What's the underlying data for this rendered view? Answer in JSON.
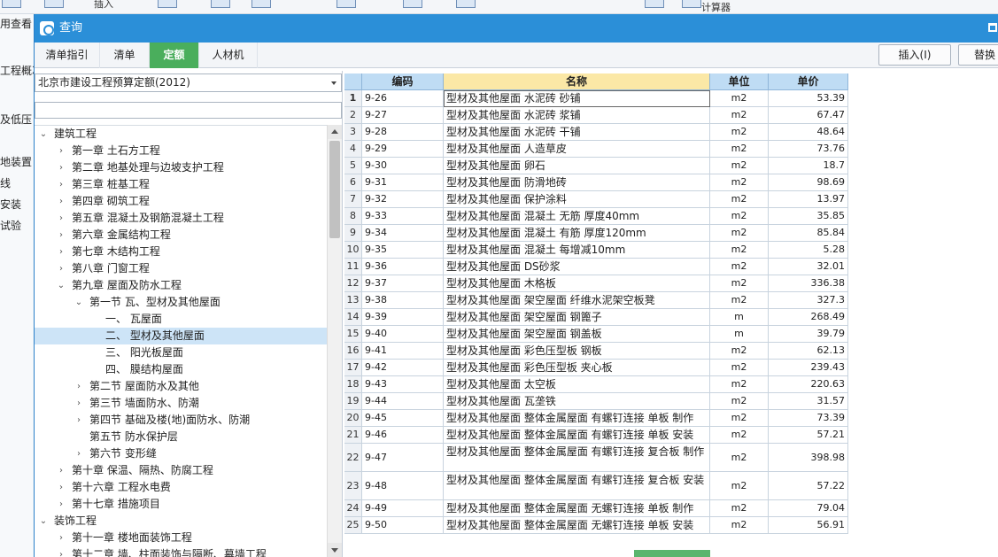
{
  "background": {
    "toolbar_items": [
      "插入",
      "计算器"
    ],
    "left_items": [
      "用查看",
      "工程概况",
      "及低压",
      "地装置",
      "线",
      "安装",
      "试验"
    ]
  },
  "dialog": {
    "title": "查询",
    "tabs": [
      "清单指引",
      "清单",
      "定额",
      "人材机"
    ],
    "active_tab": "定额",
    "insert_button": "插入(I)",
    "replace_button": "替换",
    "accent": "#4aae5c",
    "title_color": "#2b8fd8"
  },
  "left": {
    "quota_library": "北京市建设工程预算定额(2012)",
    "search_value": "",
    "tree": [
      {
        "label": "建筑工程",
        "level": 0,
        "arrow": "down"
      },
      {
        "label": "第一章 土石方工程",
        "level": 1,
        "arrow": "right"
      },
      {
        "label": "第二章 地基处理与边坡支护工程",
        "level": 1,
        "arrow": "right"
      },
      {
        "label": "第三章 桩基工程",
        "level": 1,
        "arrow": "right"
      },
      {
        "label": "第四章 砌筑工程",
        "level": 1,
        "arrow": "right"
      },
      {
        "label": "第五章 混凝土及钢筋混凝土工程",
        "level": 1,
        "arrow": "right"
      },
      {
        "label": "第六章 金属结构工程",
        "level": 1,
        "arrow": "right"
      },
      {
        "label": "第七章 木结构工程",
        "level": 1,
        "arrow": "right"
      },
      {
        "label": "第八章 门窗工程",
        "level": 1,
        "arrow": "right"
      },
      {
        "label": "第九章 屋面及防水工程",
        "level": 1,
        "arrow": "down"
      },
      {
        "label": "第一节 瓦、型材及其他屋面",
        "level": 2,
        "arrow": "down"
      },
      {
        "label": "一、 瓦屋面",
        "level": 3,
        "arrow": ""
      },
      {
        "label": "二、 型材及其他屋面",
        "level": 3,
        "arrow": "",
        "selected": true
      },
      {
        "label": "三、 阳光板屋面",
        "level": 3,
        "arrow": ""
      },
      {
        "label": "四、 膜结构屋面",
        "level": 3,
        "arrow": ""
      },
      {
        "label": "第二节 屋面防水及其他",
        "level": 2,
        "arrow": "right"
      },
      {
        "label": "第三节 墙面防水、防潮",
        "level": 2,
        "arrow": "right"
      },
      {
        "label": "第四节 基础及楼(地)面防水、防潮",
        "level": 2,
        "arrow": "right"
      },
      {
        "label": "第五节 防水保护层",
        "level": 2,
        "arrow": ""
      },
      {
        "label": "第六节 变形缝",
        "level": 2,
        "arrow": "right"
      },
      {
        "label": "第十章 保温、隔热、防腐工程",
        "level": 1,
        "arrow": "right"
      },
      {
        "label": "第十六章 工程水电费",
        "level": 1,
        "arrow": "right"
      },
      {
        "label": "第十七章 措施项目",
        "level": 1,
        "arrow": "right"
      },
      {
        "label": "装饰工程",
        "level": 0,
        "arrow": "down"
      },
      {
        "label": "第十一章 楼地面装饰工程",
        "level": 1,
        "arrow": "right"
      },
      {
        "label": "第十二章 墙、柱面装饰与隔断、幕墙工程",
        "level": 1,
        "arrow": "right"
      }
    ]
  },
  "grid": {
    "headers": {
      "code": "编码",
      "name": "名称",
      "unit": "单位",
      "price": "单价"
    },
    "rows": [
      {
        "idx": "1",
        "code": "9-26",
        "name": "型材及其他屋面 水泥砖 砂铺",
        "unit": "m2",
        "price": "53.39"
      },
      {
        "idx": "2",
        "code": "9-27",
        "name": "型材及其他屋面 水泥砖 浆铺",
        "unit": "m2",
        "price": "67.47"
      },
      {
        "idx": "3",
        "code": "9-28",
        "name": "型材及其他屋面 水泥砖 干铺",
        "unit": "m2",
        "price": "48.64"
      },
      {
        "idx": "4",
        "code": "9-29",
        "name": "型材及其他屋面 人造草皮",
        "unit": "m2",
        "price": "73.76"
      },
      {
        "idx": "5",
        "code": "9-30",
        "name": "型材及其他屋面 卵石",
        "unit": "m2",
        "price": "18.7"
      },
      {
        "idx": "6",
        "code": "9-31",
        "name": "型材及其他屋面 防滑地砖",
        "unit": "m2",
        "price": "98.69"
      },
      {
        "idx": "7",
        "code": "9-32",
        "name": "型材及其他屋面 保护涂料",
        "unit": "m2",
        "price": "13.97"
      },
      {
        "idx": "8",
        "code": "9-33",
        "name": "型材及其他屋面 混凝土 无筋 厚度40mm",
        "unit": "m2",
        "price": "35.85"
      },
      {
        "idx": "9",
        "code": "9-34",
        "name": "型材及其他屋面 混凝土 有筋 厚度120mm",
        "unit": "m2",
        "price": "85.84"
      },
      {
        "idx": "10",
        "code": "9-35",
        "name": "型材及其他屋面 混凝土 每增减10mm",
        "unit": "m2",
        "price": "5.28"
      },
      {
        "idx": "11",
        "code": "9-36",
        "name": "型材及其他屋面 DS砂浆",
        "unit": "m2",
        "price": "32.01"
      },
      {
        "idx": "12",
        "code": "9-37",
        "name": "型材及其他屋面 木格板",
        "unit": "m2",
        "price": "336.38"
      },
      {
        "idx": "13",
        "code": "9-38",
        "name": "型材及其他屋面 架空屋面 纤维水泥架空板凳",
        "unit": "m2",
        "price": "327.3"
      },
      {
        "idx": "14",
        "code": "9-39",
        "name": "型材及其他屋面 架空屋面 钢篦子",
        "unit": "m",
        "price": "268.49"
      },
      {
        "idx": "15",
        "code": "9-40",
        "name": "型材及其他屋面 架空屋面 钢盖板",
        "unit": "m",
        "price": "39.79"
      },
      {
        "idx": "16",
        "code": "9-41",
        "name": "型材及其他屋面 彩色压型板 钢板",
        "unit": "m2",
        "price": "62.13"
      },
      {
        "idx": "17",
        "code": "9-42",
        "name": "型材及其他屋面 彩色压型板 夹心板",
        "unit": "m2",
        "price": "239.43"
      },
      {
        "idx": "18",
        "code": "9-43",
        "name": "型材及其他屋面 太空板",
        "unit": "m2",
        "price": "220.63"
      },
      {
        "idx": "19",
        "code": "9-44",
        "name": "型材及其他屋面 瓦垄铁",
        "unit": "m2",
        "price": "31.57"
      },
      {
        "idx": "20",
        "code": "9-45",
        "name": "型材及其他屋面 整体金属屋面 有螺钉连接 单板 制作",
        "unit": "m2",
        "price": "73.39"
      },
      {
        "idx": "21",
        "code": "9-46",
        "name": "型材及其他屋面 整体金属屋面 有螺钉连接 单板 安装",
        "unit": "m2",
        "price": "57.21"
      },
      {
        "idx": "22",
        "code": "9-47",
        "name": "型材及其他屋面 整体金属屋面 有螺钉连接 复合板 制作",
        "unit": "m2",
        "price": "398.98"
      },
      {
        "idx": "23",
        "code": "9-48",
        "name": "型材及其他屋面 整体金属屋面 有螺钉连接 复合板 安装",
        "unit": "m2",
        "price": "57.22"
      },
      {
        "idx": "24",
        "code": "9-49",
        "name": "型材及其他屋面 整体金属屋面 无螺钉连接 单板 制作",
        "unit": "m2",
        "price": "79.04"
      },
      {
        "idx": "25",
        "code": "9-50",
        "name": "型材及其他屋面 整体金属屋面 无螺钉连接 单板 安装",
        "unit": "m2",
        "price": "56.91"
      }
    ]
  }
}
